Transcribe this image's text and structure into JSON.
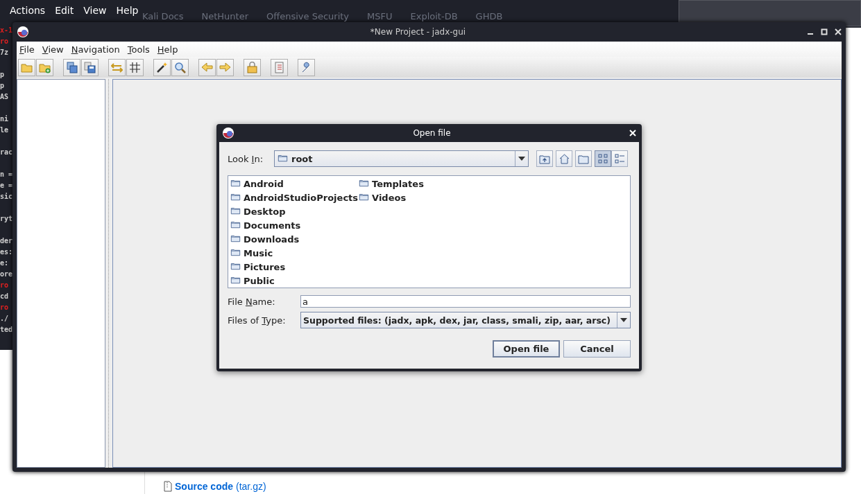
{
  "desktop": {
    "top_menu": [
      "Actions",
      "Edit",
      "View",
      "Help"
    ],
    "bookmarks": [
      "Kali Docs",
      "NetHunter",
      "Offensive Security",
      "MSFU",
      "Exploit-DB",
      "GHDB"
    ]
  },
  "terminal": {
    "lines": [
      {
        "text": "x-1",
        "kind": "prompt"
      },
      {
        "text": "ro",
        "kind": "prompt"
      },
      {
        "text": "7z",
        "kind": "plain"
      },
      {
        "kind": "blank"
      },
      {
        "text": "p",
        "kind": "plain"
      },
      {
        "text": "p",
        "kind": "plain"
      },
      {
        "text": "AS",
        "kind": "plain"
      },
      {
        "kind": "blank"
      },
      {
        "text": "ni",
        "kind": "plain"
      },
      {
        "text": "le",
        "kind": "plain"
      },
      {
        "kind": "blank"
      },
      {
        "text": "rac",
        "kind": "plain"
      },
      {
        "kind": "blank"
      },
      {
        "text": "n =",
        "kind": "plain"
      },
      {
        "text": "e =",
        "kind": "plain"
      },
      {
        "text": "sic",
        "kind": "plain"
      },
      {
        "kind": "blank"
      },
      {
        "text": "ryt",
        "kind": "plain"
      },
      {
        "kind": "blank"
      },
      {
        "text": "der",
        "kind": "plain"
      },
      {
        "text": "es:",
        "kind": "plain"
      },
      {
        "text": "e:",
        "kind": "plain"
      },
      {
        "text": "ore",
        "kind": "plain"
      },
      {
        "text": "ro",
        "kind": "prompt"
      },
      {
        "text": "cd",
        "kind": "plain"
      },
      {
        "text": "ro",
        "kind": "prompt"
      },
      {
        "text": "./",
        "kind": "plain"
      },
      {
        "text": "ted",
        "kind": "plain"
      }
    ]
  },
  "window": {
    "title": "*New Project - jadx-gui",
    "menu": [
      {
        "key": "F",
        "after": "ile"
      },
      {
        "key": "V",
        "after": "iew"
      },
      {
        "key": "N",
        "after": "avigation"
      },
      {
        "key": "T",
        "after": "ools"
      },
      {
        "key": "H",
        "after": "elp"
      }
    ]
  },
  "dialog": {
    "title": "Open file",
    "look_in": {
      "label": {
        "before": "Look ",
        "key": "I",
        "after": "n:"
      },
      "value": "root"
    },
    "view_modes": [
      {
        "selected": true
      },
      {
        "selected": false
      }
    ],
    "files": [
      "Android",
      "AndroidStudioProjects",
      "Desktop",
      "Documents",
      "Downloads",
      "Music",
      "Pictures",
      "Public",
      "Templates",
      "Videos"
    ],
    "file_name": {
      "label": {
        "before": "File ",
        "key": "N",
        "after": "ame:"
      },
      "value": "a"
    },
    "file_type": {
      "label": {
        "before": "Files of ",
        "key": "T",
        "after": "ype:"
      },
      "value": "Supported files: (jadx, apk, dex, jar, class, smali, zip, aar, arsc)"
    },
    "buttons": [
      {
        "label": "Open file",
        "default": true
      },
      {
        "label": "Cancel",
        "default": false
      }
    ]
  },
  "page_below": {
    "link": "Source code",
    "note": "(tar.gz)"
  }
}
